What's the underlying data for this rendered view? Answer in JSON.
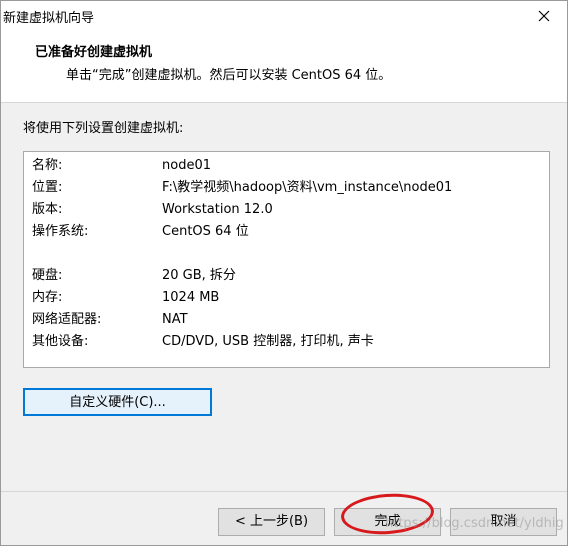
{
  "window": {
    "title": "新建虚拟机向导"
  },
  "header": {
    "title": "已准备好创建虚拟机",
    "subtitle": "单击“完成”创建虚拟机。然后可以安装 CentOS 64 位。"
  },
  "section_label": "将使用下列设置创建虚拟机:",
  "summary": [
    {
      "key": "名称:",
      "value": "node01"
    },
    {
      "key": "位置:",
      "value": "F:\\教学视频\\hadoop\\资料\\vm_instance\\node01"
    },
    {
      "key": "版本:",
      "value": "Workstation 12.0"
    },
    {
      "key": "操作系统:",
      "value": "CentOS 64 位"
    },
    {
      "key": "硬盘:",
      "value": "20 GB, 拆分"
    },
    {
      "key": "内存:",
      "value": "1024 MB"
    },
    {
      "key": "网络适配器:",
      "value": "NAT"
    },
    {
      "key": "其他设备:",
      "value": "CD/DVD, USB 控制器, 打印机, 声卡"
    }
  ],
  "buttons": {
    "customize": "自定义硬件(C)...",
    "back": "< 上一步(B)",
    "finish": "完成",
    "cancel": "取消"
  },
  "watermark": "https://blog.csdn.net/yldhig",
  "colors": {
    "accent": "#0078d7",
    "highlight": "#d7191c"
  }
}
